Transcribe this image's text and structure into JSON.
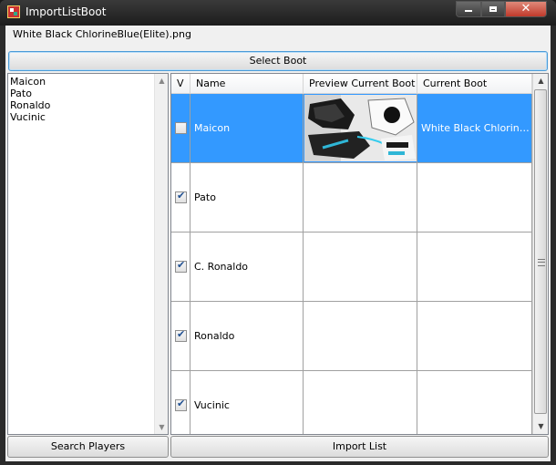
{
  "window": {
    "title": "ImportListBoot"
  },
  "file_label": "White Black ChlorineBlue(Elite).png",
  "buttons": {
    "select_boot": "Select Boot",
    "search_players": "Search Players",
    "import_list": "Import List"
  },
  "players_list": [
    "Maicon",
    "Pato",
    "Ronaldo",
    "Vucinic"
  ],
  "grid": {
    "columns": [
      "V",
      "Name",
      "Preview Current Boot",
      "Current Boot"
    ],
    "rows": [
      {
        "checked": false,
        "name": "Maicon",
        "current_boot": "White Black ChlorineBlue(Elite).png",
        "has_preview": true,
        "selected": true
      },
      {
        "checked": true,
        "name": "Pato",
        "current_boot": "",
        "has_preview": false,
        "selected": false
      },
      {
        "checked": true,
        "name": "C. Ronaldo",
        "current_boot": "",
        "has_preview": false,
        "selected": false
      },
      {
        "checked": true,
        "name": "Ronaldo",
        "current_boot": "",
        "has_preview": false,
        "selected": false
      },
      {
        "checked": true,
        "name": "Vucinic",
        "current_boot": "",
        "has_preview": false,
        "selected": false
      }
    ]
  },
  "icons": {
    "app": "app-icon",
    "minimize": "minimize-icon",
    "maximize": "maximize-icon",
    "close": "close-icon"
  },
  "colors": {
    "selection": "#3399ff",
    "close_button": "#c0392b"
  }
}
